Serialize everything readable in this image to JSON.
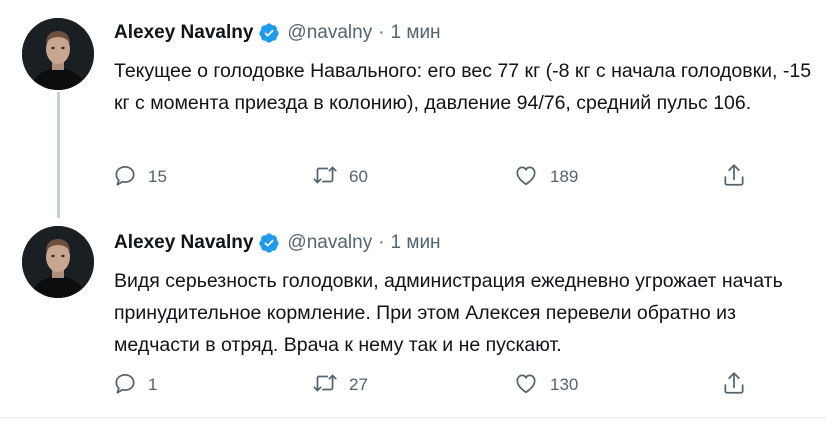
{
  "colors": {
    "verified": "#1d9bf0",
    "text": "#0f1419",
    "muted": "#536471",
    "thread_line": "#c4cfd6"
  },
  "tweets": [
    {
      "author_name": "Alexey Navalny",
      "verified_icon": "verified-badge-icon",
      "handle": "@navalny",
      "separator": "·",
      "time": "1 мин",
      "text": "Текущее о голодовке Навального: его вес 77 кг (-8 кг с начала голодовки, -15 кг с момента приезда в колонию), давление 94/76, средний пульс 106.",
      "replies": "15",
      "retweets": "60",
      "likes": "189"
    },
    {
      "author_name": "Alexey Navalny",
      "verified_icon": "verified-badge-icon",
      "handle": "@navalny",
      "separator": "·",
      "time": "1 мин",
      "text": "Видя серьезность голодовки, администрация ежедневно угрожает начать принудительное кормление. При этом Алексея перевели обратно из медчасти в отряд. Врача к нему так и не пускают.",
      "replies": "1",
      "retweets": "27",
      "likes": "130"
    }
  ]
}
